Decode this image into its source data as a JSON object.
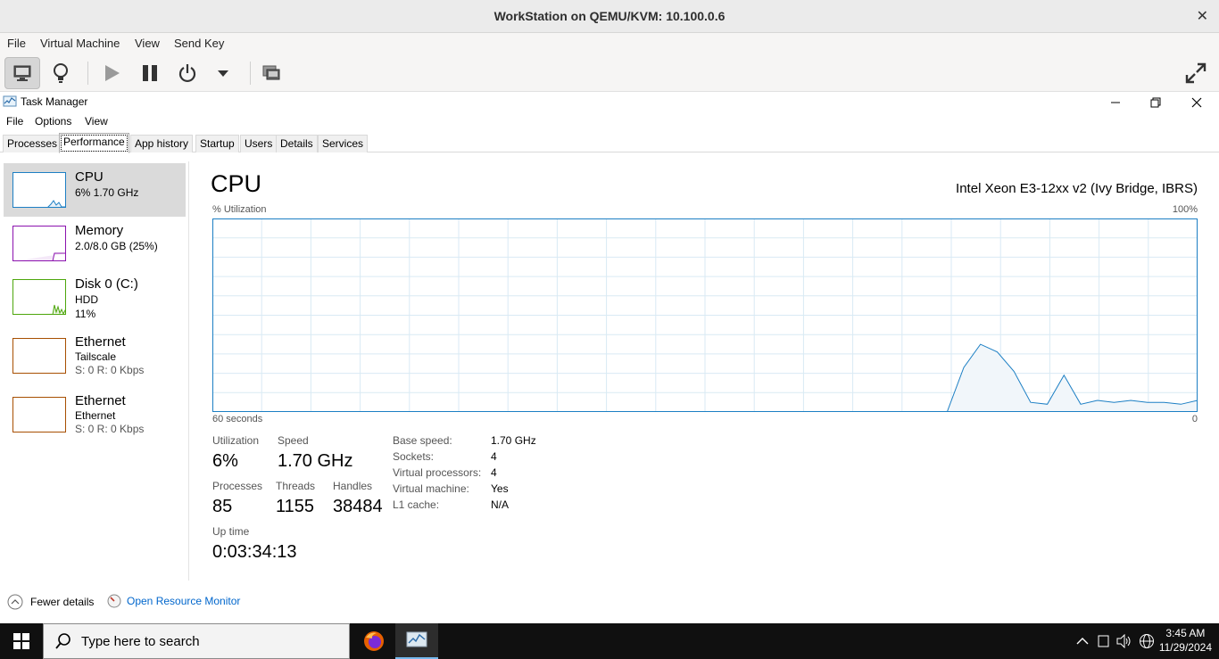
{
  "vm": {
    "title": "WorkStation on QEMU/KVM: 10.100.0.6",
    "menu": [
      "File",
      "Virtual Machine",
      "View",
      "Send Key"
    ]
  },
  "taskmanager": {
    "title": "Task Manager",
    "menu": [
      "File",
      "Options",
      "View"
    ],
    "tabs": [
      "Processes",
      "Performance",
      "App history",
      "Startup",
      "Users",
      "Details",
      "Services"
    ],
    "active_tab": "Performance",
    "side": [
      {
        "name": "CPU",
        "line2": "6%  1.70 GHz",
        "line3": "",
        "color": "#1c7fc4"
      },
      {
        "name": "Memory",
        "line2": "2.0/8.0 GB (25%)",
        "line3": "",
        "color": "#8b12ae"
      },
      {
        "name": "Disk 0 (C:)",
        "line2": "HDD",
        "line3": "11%",
        "color": "#4da60c"
      },
      {
        "name": "Ethernet",
        "line2": "Tailscale",
        "line3": "S: 0  R: 0 Kbps",
        "color": "#a74f01"
      },
      {
        "name": "Ethernet",
        "line2": "Ethernet",
        "line3": "S: 0  R: 0 Kbps",
        "color": "#a74f01"
      }
    ],
    "cpu": {
      "title": "CPU",
      "model": "Intel Xeon E3-12xx v2 (Ivy Bridge, IBRS)",
      "util_label": "% Utilization",
      "util_max": "100%",
      "x_left": "60 seconds",
      "x_right": "0",
      "stats": {
        "utilization_label": "Utilization",
        "utilization": "6%",
        "speed_label": "Speed",
        "speed": "1.70 GHz",
        "processes_label": "Processes",
        "processes": "85",
        "threads_label": "Threads",
        "threads": "1155",
        "handles_label": "Handles",
        "handles": "38484",
        "uptime_label": "Up time",
        "uptime": "0:03:34:13"
      },
      "details": [
        {
          "key": "Base speed:",
          "value": "1.70 GHz"
        },
        {
          "key": "Sockets:",
          "value": "4"
        },
        {
          "key": "Virtual processors:",
          "value": "4"
        },
        {
          "key": "Virtual machine:",
          "value": "Yes"
        },
        {
          "key": "L1 cache:",
          "value": "N/A"
        }
      ],
      "history_percent": [
        0,
        0,
        0,
        0,
        0,
        0,
        0,
        0,
        0,
        0,
        0,
        0,
        0,
        0,
        0,
        0,
        0,
        0,
        0,
        0,
        0,
        0,
        0,
        0,
        0,
        0,
        0,
        0,
        0,
        0,
        0,
        0,
        0,
        0,
        0,
        0,
        0,
        0,
        0,
        0,
        0,
        0,
        0,
        0,
        0,
        23,
        35,
        31,
        21,
        5,
        4,
        19,
        4,
        6,
        5,
        6,
        5,
        5,
        4,
        6
      ]
    },
    "footer": {
      "fewer_details": "Fewer details",
      "open_resource_monitor": "Open Resource Monitor"
    }
  },
  "taskbar": {
    "search_placeholder": "Type here to search",
    "time": "3:45 AM",
    "date": "11/29/2024"
  },
  "colors": {
    "cpu_accent": "#1c7fc4",
    "cpu_fill": "#f1f6fa",
    "grid": "#d9eaf4"
  }
}
